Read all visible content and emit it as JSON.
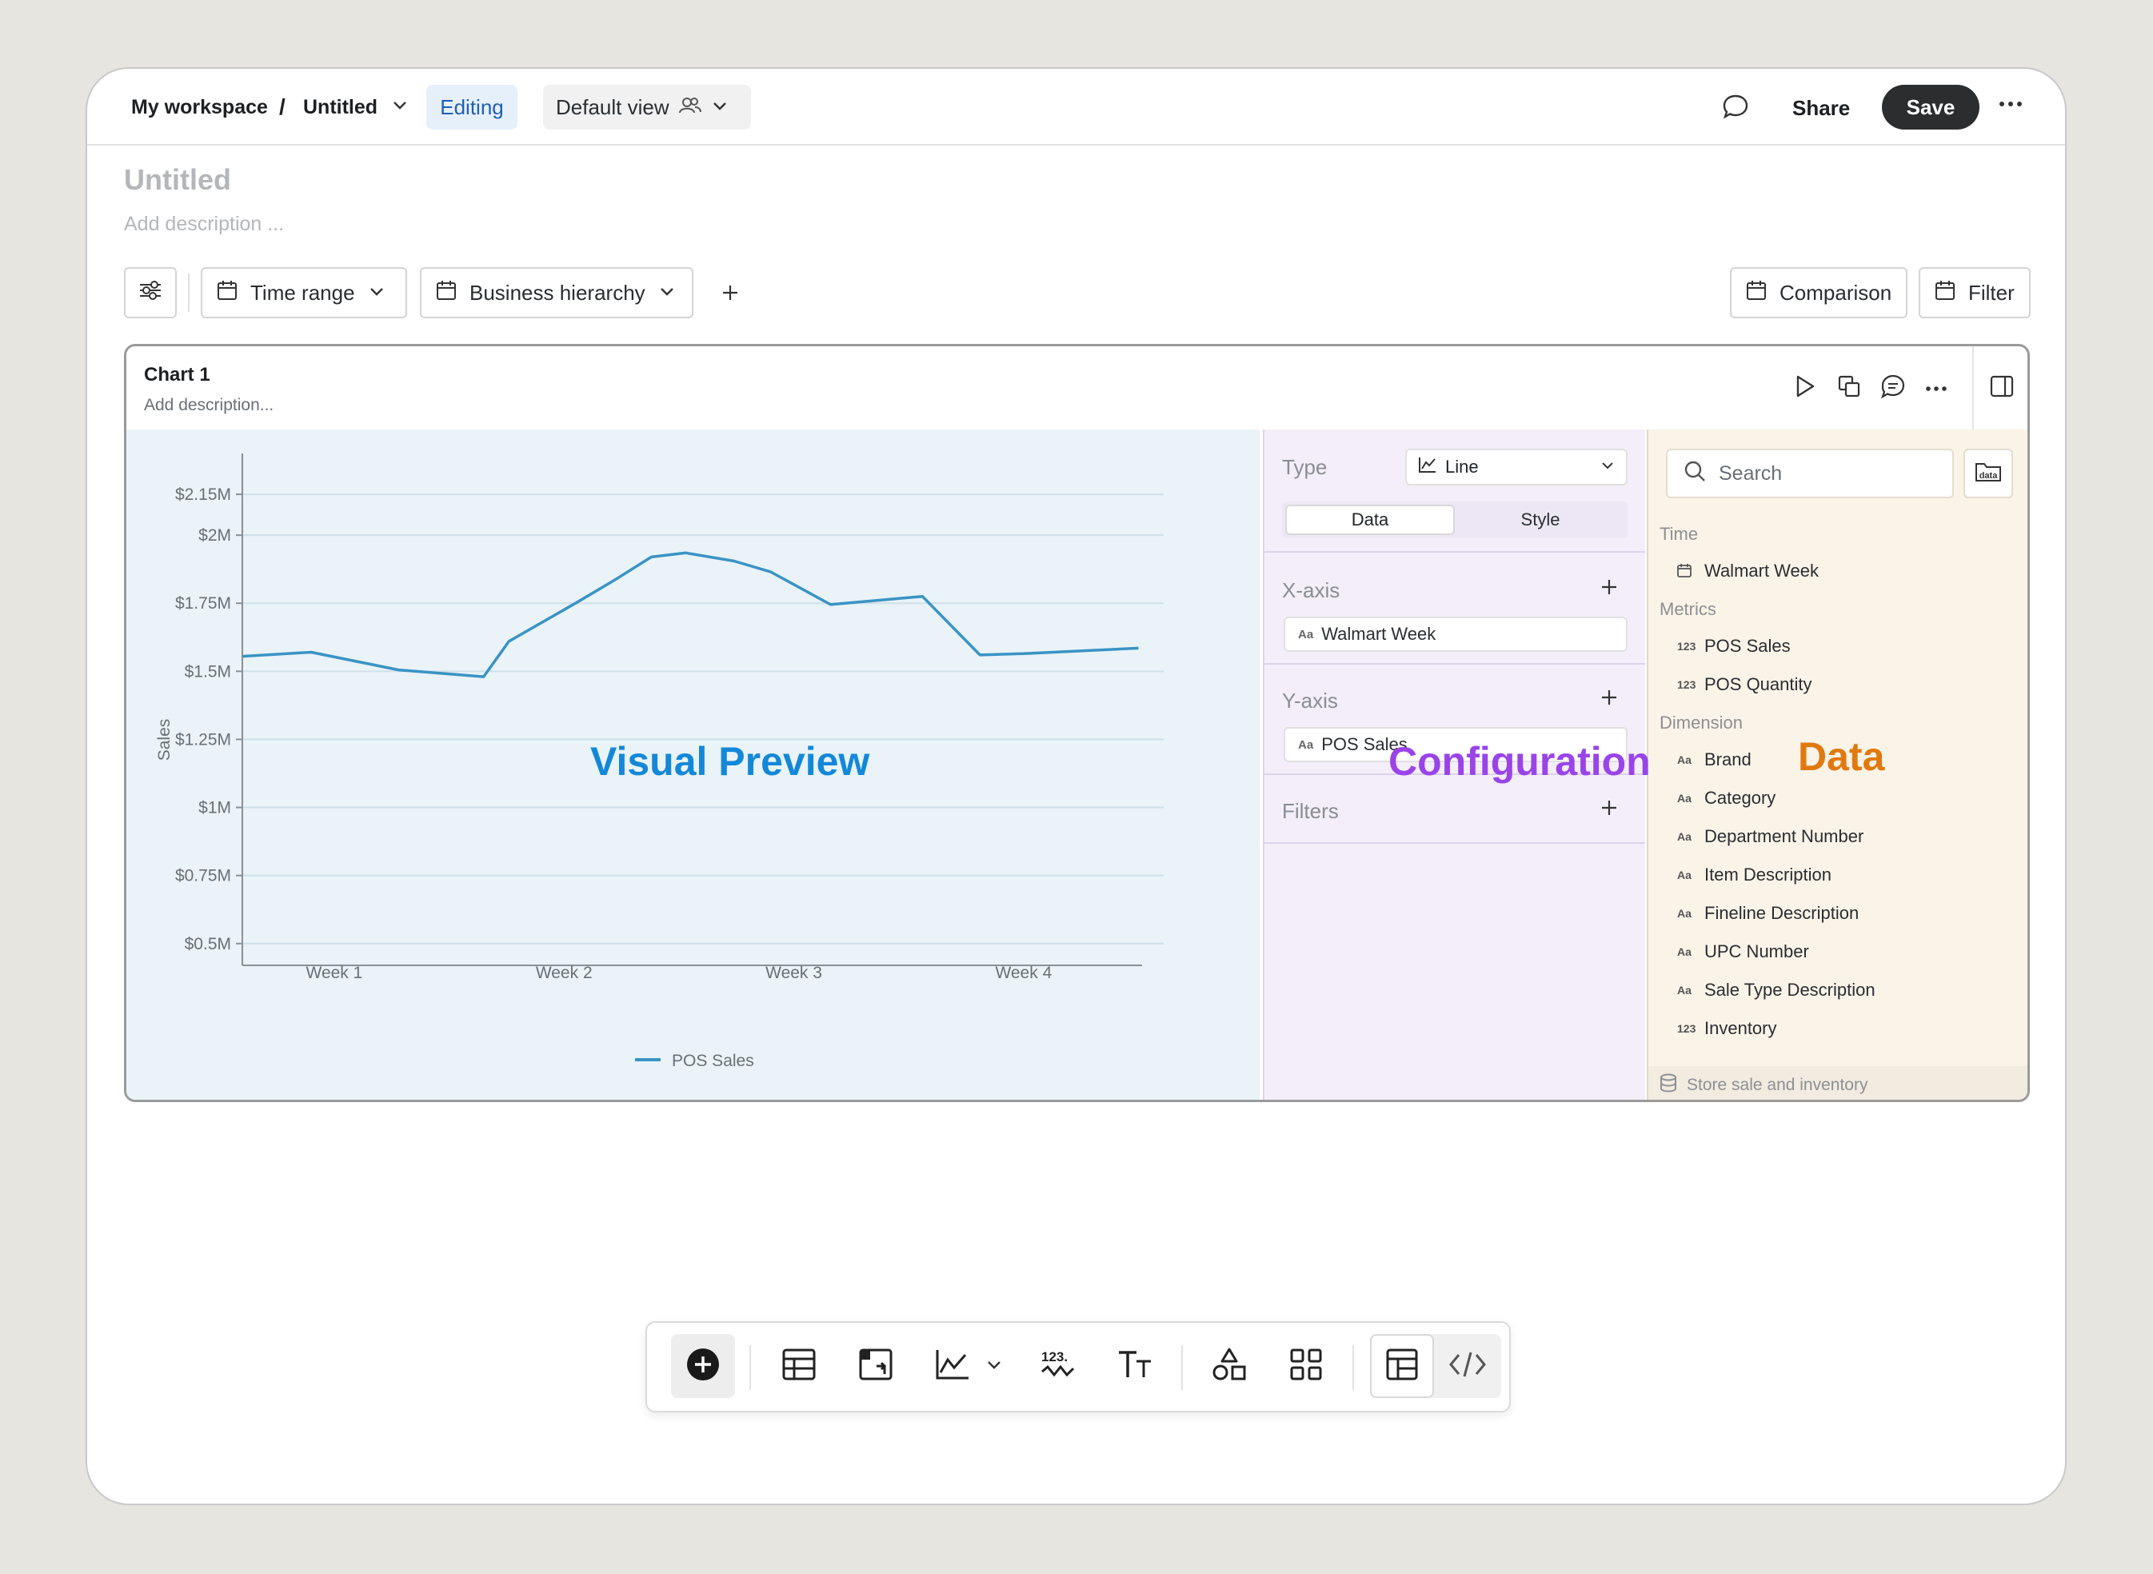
{
  "header": {
    "workspace": "My workspace",
    "separator": "/",
    "doc_title": "Untitled",
    "mode_badge": "Editing",
    "view_label": "Default view",
    "share_label": "Share",
    "save_label": "Save"
  },
  "page": {
    "title": "Untitled",
    "description_placeholder": "Add description ..."
  },
  "controls": {
    "time_range": "Time range",
    "business_hierarchy": "Business hierarchy",
    "comparison": "Comparison",
    "filter": "Filter"
  },
  "chart_card": {
    "title": "Chart 1",
    "description_placeholder": "Add description..."
  },
  "overlays": {
    "preview": "Visual Preview",
    "configuration": "Configuration",
    "data": "Data"
  },
  "config": {
    "type_label": "Type",
    "type_value": "Line",
    "tabs": [
      "Data",
      "Style"
    ],
    "active_tab": "Data",
    "x_axis_label": "X-axis",
    "x_axis_field": "Walmart Week",
    "y_axis_label": "Y-axis",
    "y_axis_field": "POS Sales",
    "filters_label": "Filters"
  },
  "data_panel": {
    "search_placeholder": "Search",
    "groups": [
      {
        "title": "Time",
        "fields": [
          {
            "type": "calendar",
            "name": "Walmart Week"
          }
        ]
      },
      {
        "title": "Metrics",
        "fields": [
          {
            "type": "123",
            "name": "POS Sales"
          },
          {
            "type": "123",
            "name": "POS Quantity"
          }
        ]
      },
      {
        "title": "Dimension",
        "fields": [
          {
            "type": "Aa",
            "name": "Brand"
          },
          {
            "type": "Aa",
            "name": "Category"
          },
          {
            "type": "Aa",
            "name": "Department Number"
          },
          {
            "type": "Aa",
            "name": "Item Description"
          },
          {
            "type": "Aa",
            "name": "Fineline Description"
          },
          {
            "type": "Aa",
            "name": "UPC Number"
          },
          {
            "type": "Aa",
            "name": "Sale Type Description"
          },
          {
            "type": "123",
            "name": "Inventory"
          }
        ]
      }
    ],
    "source": "Store sale and inventory"
  },
  "chart_data": {
    "type": "line",
    "ylabel": "Sales",
    "xlabel": "",
    "y_ticks": [
      "$0.5M",
      "$0.75M",
      "$1M",
      "$1.25M",
      "$1.5M",
      "$1.75M",
      "$2M",
      "$2.15M"
    ],
    "y_tick_values": [
      0.5,
      0.75,
      1.0,
      1.25,
      1.5,
      1.75,
      2.0,
      2.15
    ],
    "ylim": [
      0.42,
      2.3
    ],
    "x_ticks": [
      "Week 1",
      "Week 2",
      "Week 3",
      "Week 4"
    ],
    "x_tick_positions": [
      1,
      2,
      3,
      4
    ],
    "xlim": [
      0.6,
      4.62
    ],
    "series": [
      {
        "name": "POS Sales",
        "color": "#3a93c4",
        "x": [
          0.6,
          0.9,
          1.28,
          1.65,
          1.76,
          2.05,
          2.22,
          2.38,
          2.53,
          2.74,
          2.9,
          3.16,
          3.56,
          3.81,
          4.0,
          4.5
        ],
        "y": [
          1.555,
          1.57,
          1.505,
          1.48,
          1.61,
          1.75,
          1.835,
          1.92,
          1.935,
          1.905,
          1.865,
          1.745,
          1.775,
          1.56,
          1.565,
          1.585
        ]
      }
    ],
    "legend": "bottom",
    "grid": true
  },
  "colors": {
    "accent": "#1f5fb5",
    "preview_overlay": "#1488d8",
    "config_overlay": "#9a44e8",
    "data_overlay": "#e07a10"
  }
}
